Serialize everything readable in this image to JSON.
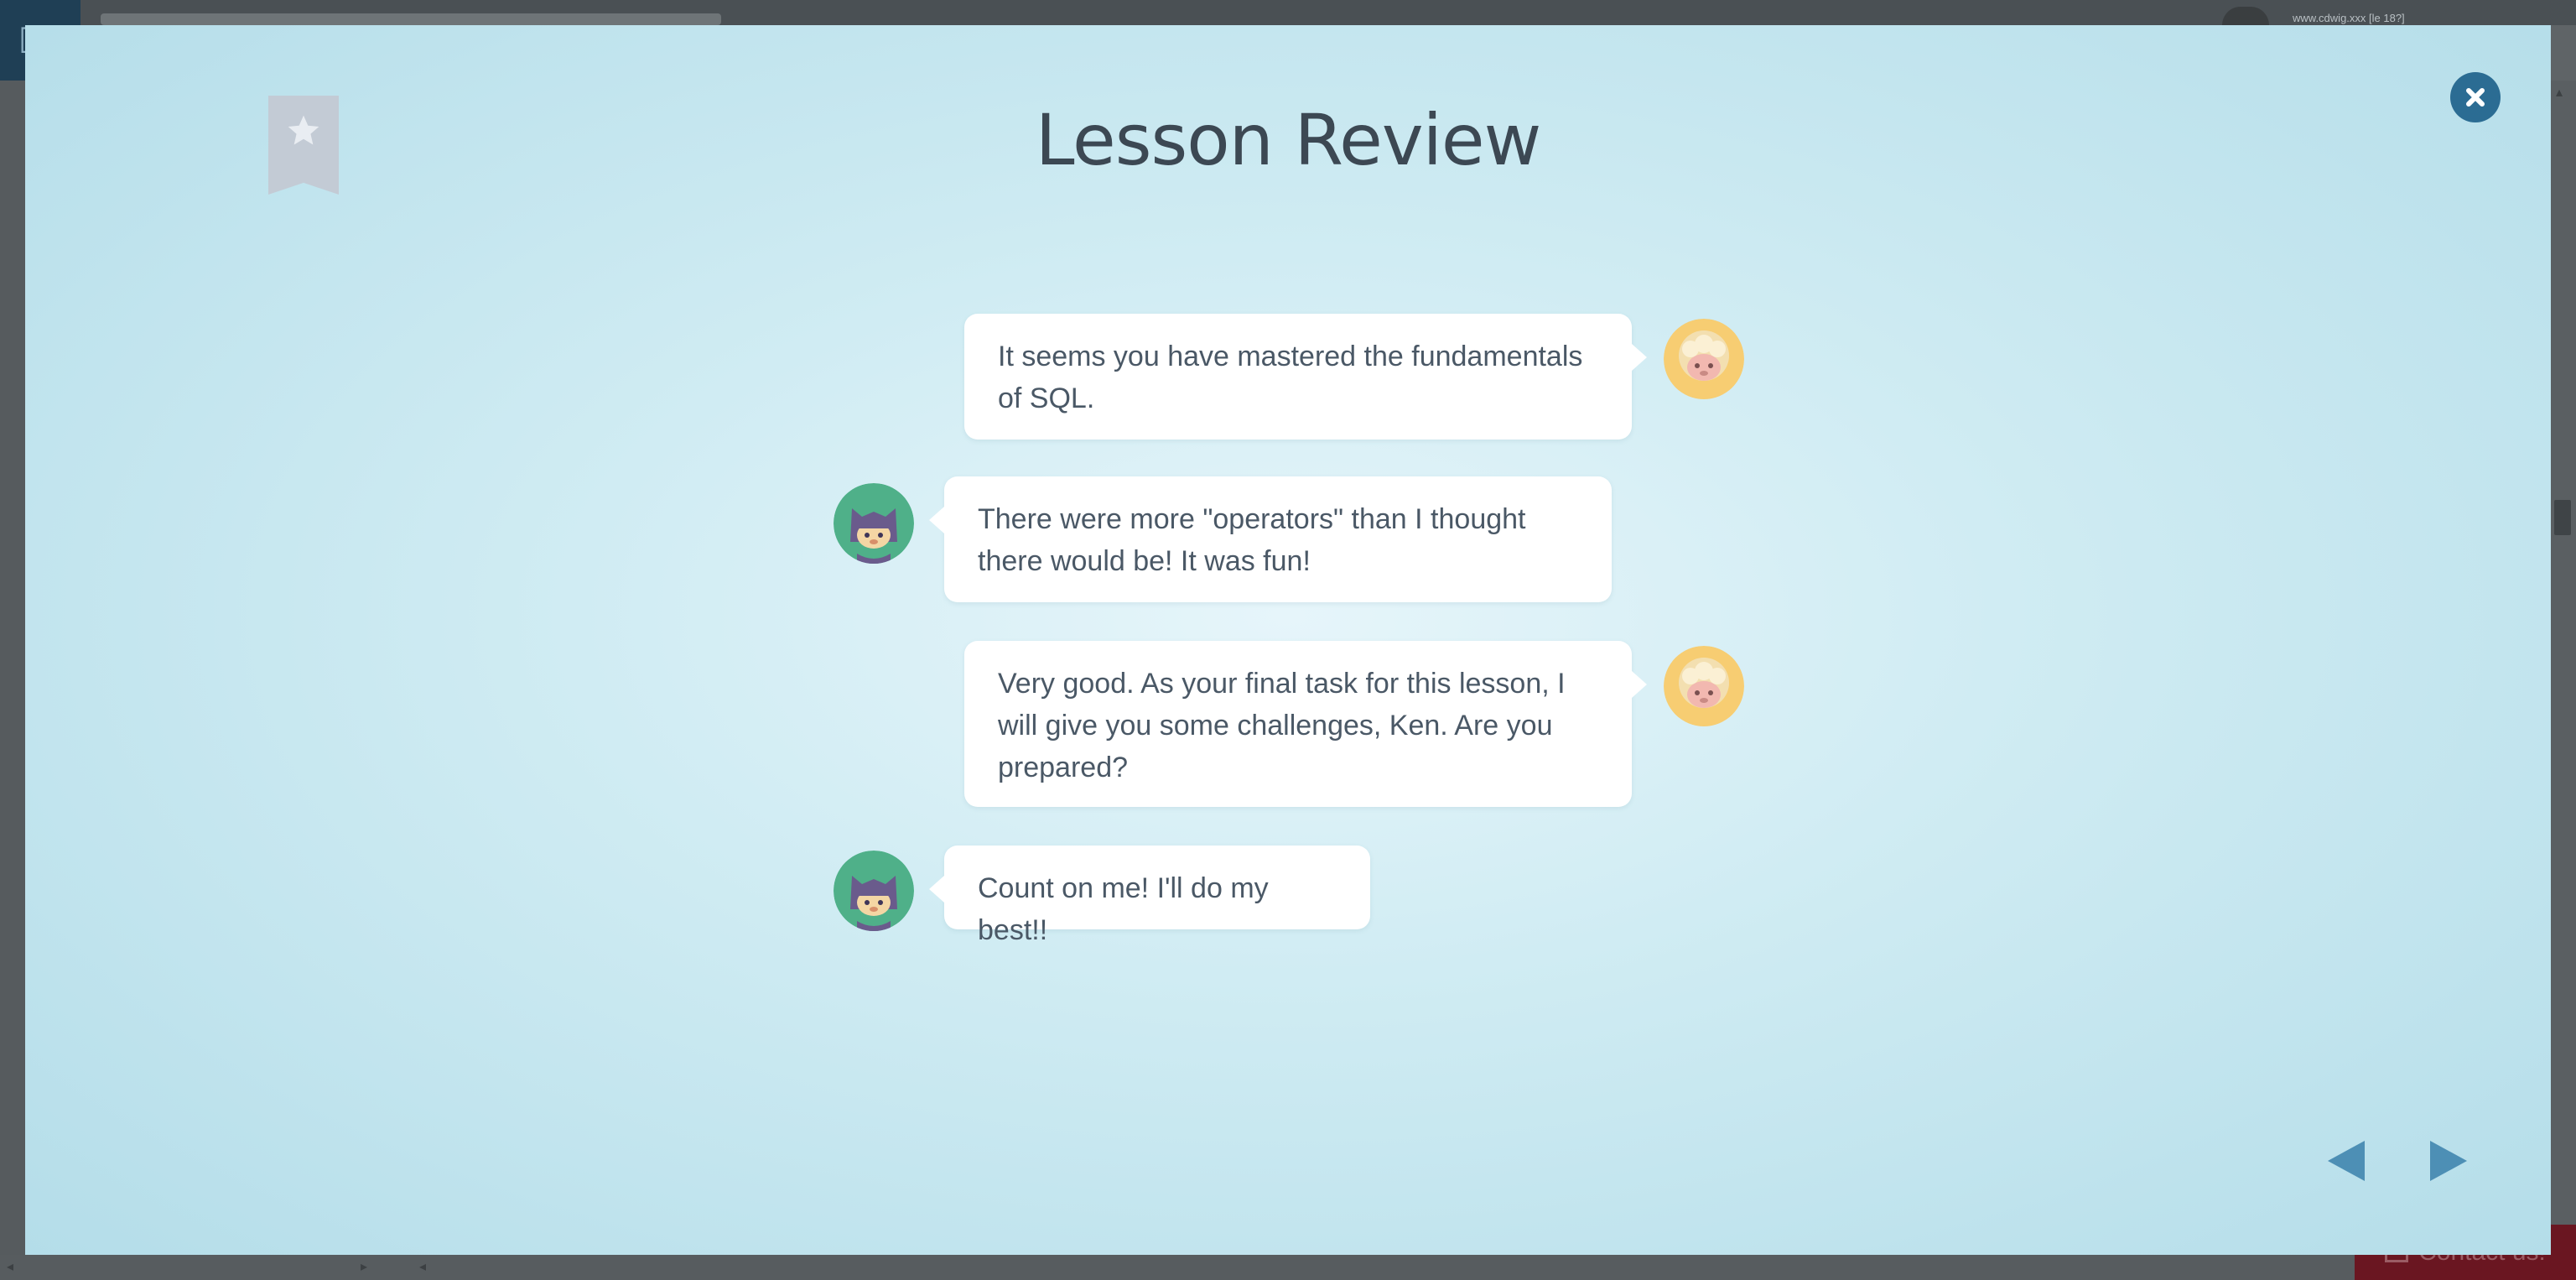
{
  "app": {
    "user_info": "www.cdwig.xxx [le 18?]",
    "contact_label": "Contact us!"
  },
  "modal": {
    "title": "Lesson Review",
    "messages": [
      {
        "speaker": "teacher",
        "text": "It seems you have mastered the fundamentals of SQL."
      },
      {
        "speaker": "student",
        "text": "There were more \"operators\" than I thought there would be! It was fun!"
      },
      {
        "speaker": "teacher",
        "text": "Very good. As your final task for this lesson, I will give you some challenges, Ken. Are you prepared?"
      },
      {
        "speaker": "student",
        "text": "Count on me! I'll do my best!!"
      }
    ]
  },
  "colors": {
    "modal_bg": "#d0ecf3",
    "title": "#3c4853",
    "bubble_text": "#4a5866",
    "close_button": "#2b6c93",
    "nav_arrows": "#4d8fb5",
    "bookmark": "#c3cbd5",
    "contact_bg": "#6a1621"
  },
  "icons": {
    "bookmark": "star-bookmark-icon",
    "close": "close-x-icon",
    "prev": "triangle-left-icon",
    "next": "triangle-right-icon",
    "teacher_avatar": "sheep-avatar-icon",
    "student_avatar": "cat-hood-avatar-icon",
    "contact": "mail-icon"
  }
}
